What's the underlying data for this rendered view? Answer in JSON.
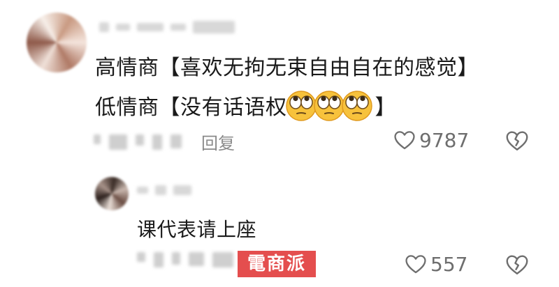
{
  "comment": {
    "text_line_1": "高情商【喜欢无拘无束自由自在的感觉】",
    "text_line_2_prefix": "低情商【没有话语权",
    "text_line_2_suffix": "】",
    "emoji": "eye-roll-emoji",
    "emoji_count": 3,
    "reply_label": "回复",
    "like_count": "9787",
    "icons": {
      "like": "heart-outline-icon",
      "dislike": "broken-heart-icon"
    }
  },
  "reply": {
    "text": "课代表请上座",
    "like_count": "557",
    "icons": {
      "like": "heart-outline-icon",
      "dislike": "broken-heart-icon"
    }
  },
  "watermark": {
    "text": "電商派",
    "color": "#e23b3b"
  },
  "colors": {
    "text": "#1a1a1a",
    "secondary": "#8a8a8a",
    "icon": "#6e6e6e"
  }
}
